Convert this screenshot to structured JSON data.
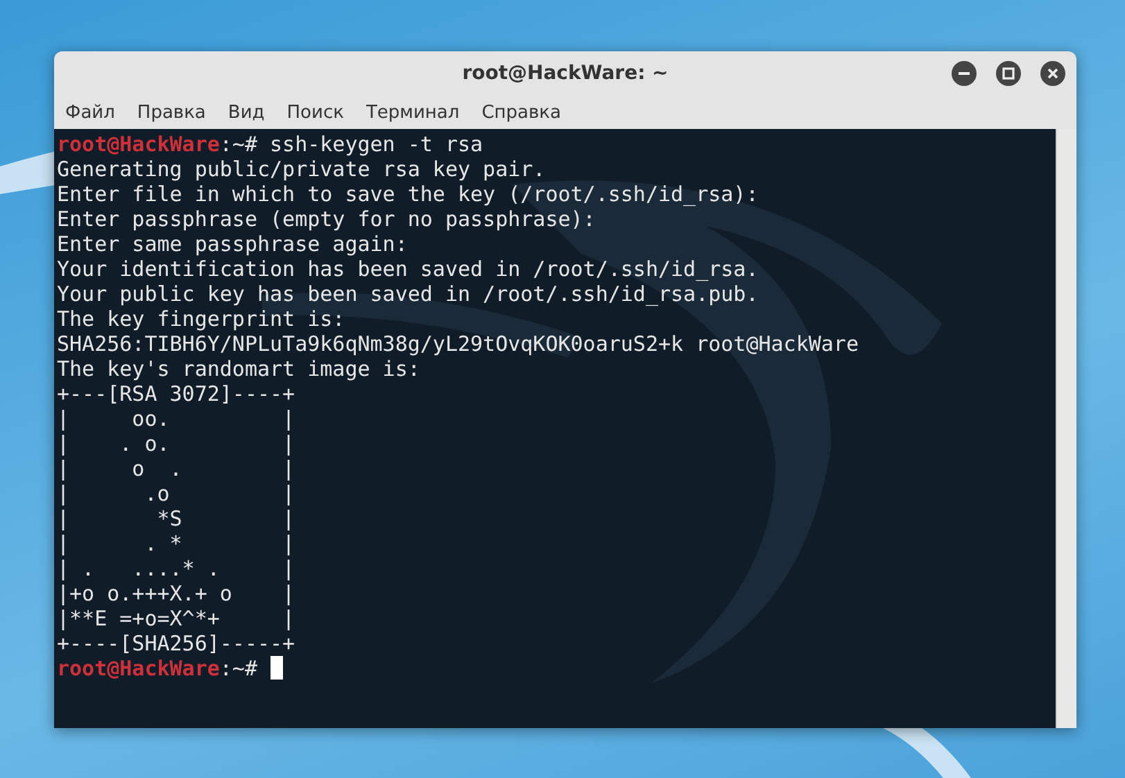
{
  "window": {
    "title": "root@HackWare: ~"
  },
  "menu": [
    "Файл",
    "Правка",
    "Вид",
    "Поиск",
    "Терминал",
    "Справка"
  ],
  "terminal": {
    "lines": [
      {
        "kind": "prompt",
        "user": "root@HackWare",
        "path": ":~#",
        "command": "ssh-keygen -t rsa"
      },
      {
        "kind": "output",
        "text": "Generating public/private rsa key pair."
      },
      {
        "kind": "output",
        "text": "Enter file in which to save the key (/root/.ssh/id_rsa):"
      },
      {
        "kind": "output",
        "text": "Enter passphrase (empty for no passphrase):"
      },
      {
        "kind": "output",
        "text": "Enter same passphrase again:"
      },
      {
        "kind": "output",
        "text": "Your identification has been saved in /root/.ssh/id_rsa."
      },
      {
        "kind": "output",
        "text": "Your public key has been saved in /root/.ssh/id_rsa.pub."
      },
      {
        "kind": "output",
        "text": "The key fingerprint is:"
      },
      {
        "kind": "output",
        "text": "SHA256:TIBH6Y/NPLuTa9k6qNm38g/yL29tOvqKOK0oaruS2+k root@HackWare"
      },
      {
        "kind": "output",
        "text": "The key's randomart image is:"
      },
      {
        "kind": "output",
        "text": "+---[RSA 3072]----+"
      },
      {
        "kind": "output",
        "text": "|     oo.         |"
      },
      {
        "kind": "output",
        "text": "|    . o.         |"
      },
      {
        "kind": "output",
        "text": "|     o  .        |"
      },
      {
        "kind": "output",
        "text": "|      .o         |"
      },
      {
        "kind": "output",
        "text": "|       *S        |"
      },
      {
        "kind": "output",
        "text": "|      . *        |"
      },
      {
        "kind": "output",
        "text": "| .   ....* .     |"
      },
      {
        "kind": "output",
        "text": "|+o o.+++X.+ o    |"
      },
      {
        "kind": "output",
        "text": "|**E =+o=X^*+     |"
      },
      {
        "kind": "output",
        "text": "+----[SHA256]-----+"
      },
      {
        "kind": "prompt",
        "user": "root@HackWare",
        "path": ":~#",
        "cursor": true
      }
    ]
  }
}
